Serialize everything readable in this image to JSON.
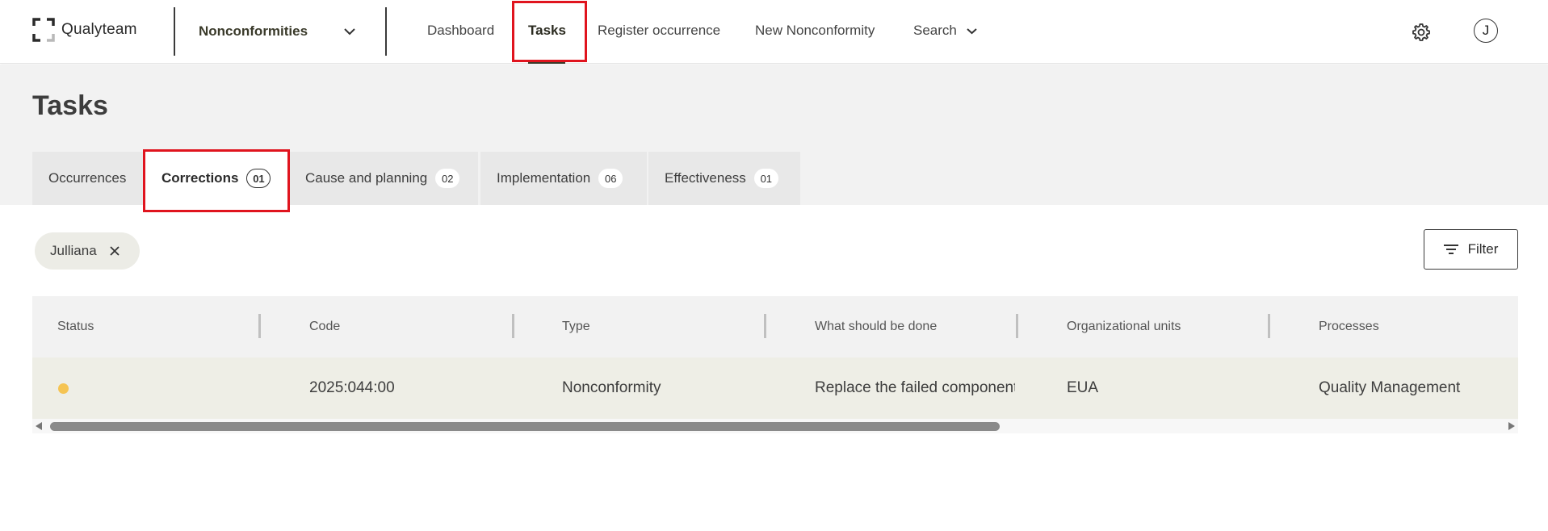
{
  "app": {
    "brand": "Qualyteam",
    "module": "Nonconformities"
  },
  "nav": {
    "items": [
      "Dashboard",
      "Tasks",
      "Register occurrence",
      "New Nonconformity",
      "Search"
    ],
    "active": "Tasks"
  },
  "user": {
    "initial": "J"
  },
  "page": {
    "title": "Tasks"
  },
  "tabs": [
    {
      "label": "Occurrences",
      "count": ""
    },
    {
      "label": "Corrections",
      "count": "01"
    },
    {
      "label": "Cause and planning",
      "count": "02"
    },
    {
      "label": "Implementation",
      "count": "06"
    },
    {
      "label": "Effectiveness",
      "count": "01"
    }
  ],
  "active_tab": "Corrections",
  "filter_chip": {
    "label": "Julliana"
  },
  "filter_button": {
    "label": "Filter"
  },
  "table": {
    "columns": [
      "Status",
      "Code",
      "Type",
      "What should be done",
      "Organizational units",
      "Processes"
    ],
    "rows": [
      {
        "status_color": "#f5c453",
        "code": "2025:044:00",
        "type": "Nonconformity",
        "what": "Replace the failed component",
        "units": "EUA",
        "processes": "Quality Management"
      }
    ]
  },
  "colors": {
    "highlight": "#e0141e",
    "status_pending": "#f5c453",
    "row_bg": "#eeeee6"
  }
}
